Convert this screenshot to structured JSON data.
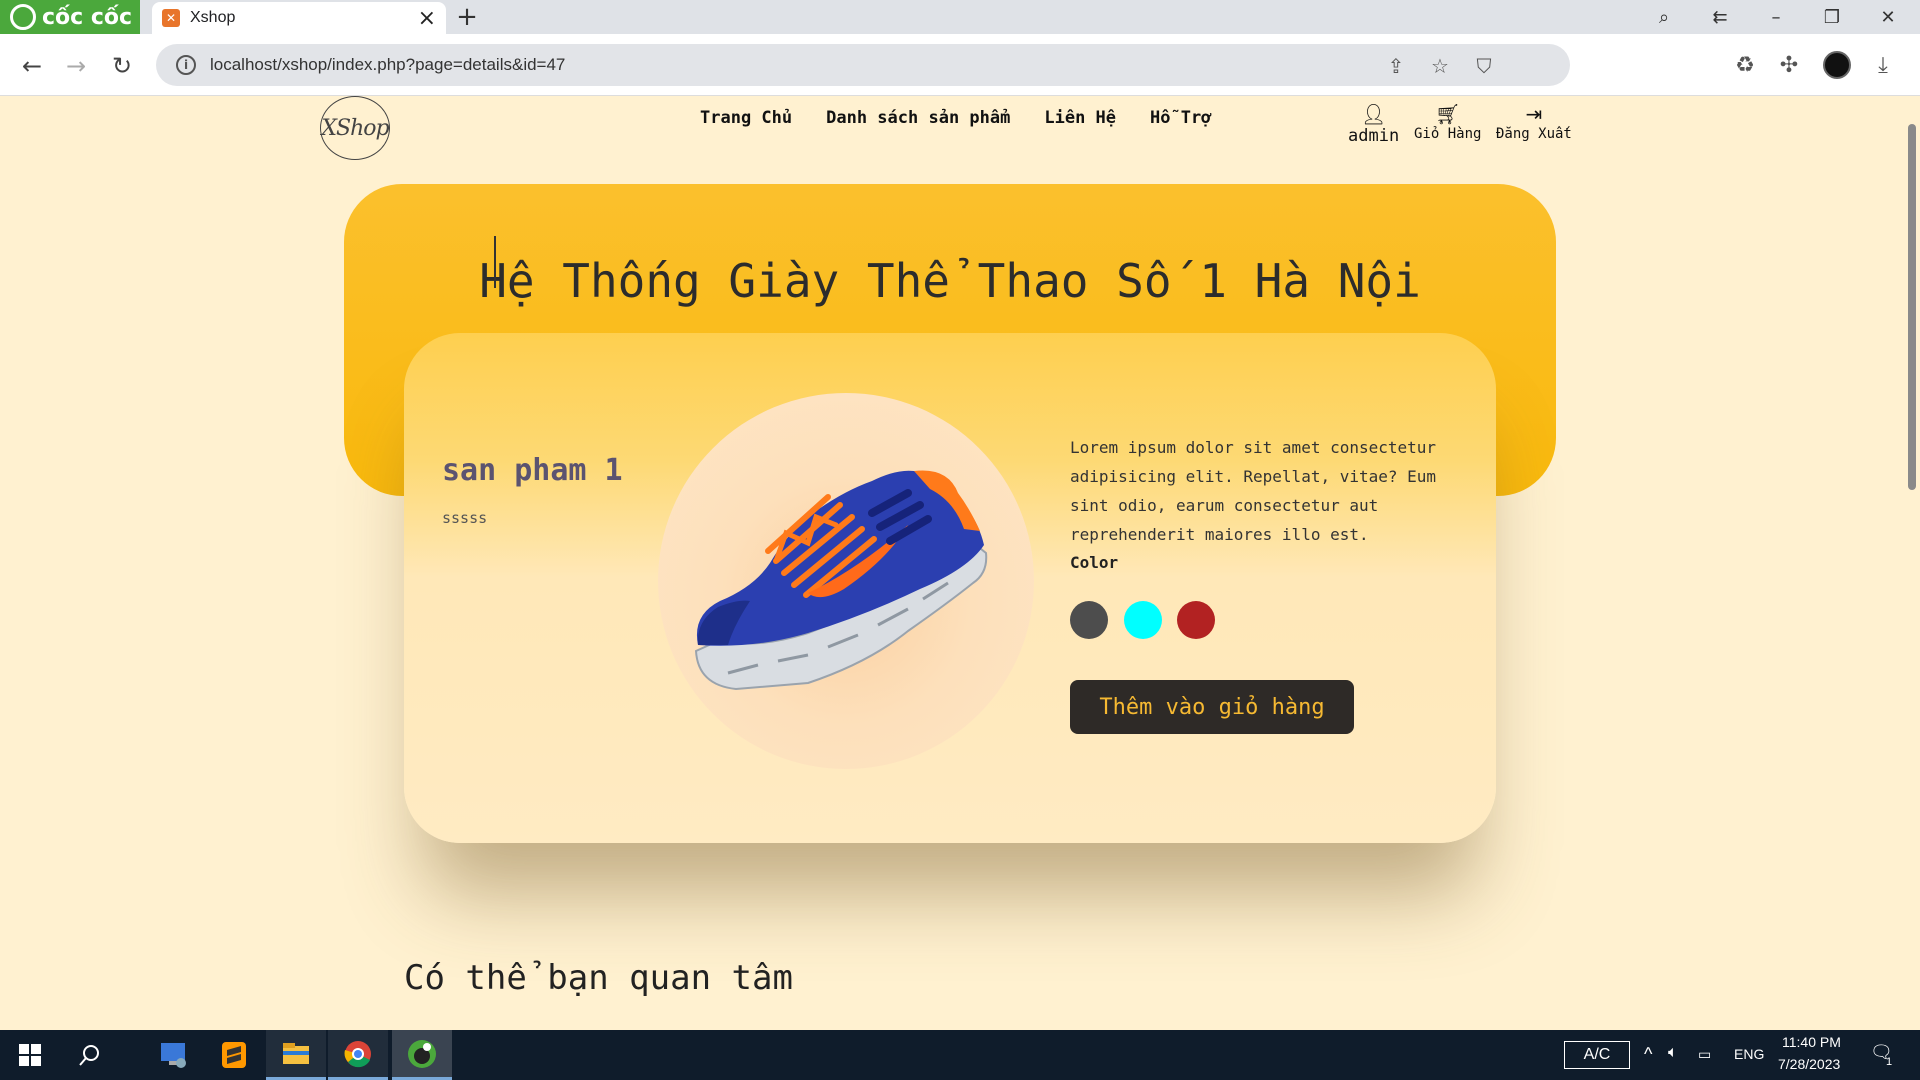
{
  "browser": {
    "brand": "cốc cốc",
    "tab_title": "Xshop",
    "url": "localhost/xshop/index.php?page=details&id=47",
    "icons": [
      "back-icon",
      "forward-icon",
      "reload-icon",
      "info-icon",
      "share-icon",
      "star-icon",
      "shield-icon",
      "recycle-icon",
      "puzzle-icon",
      "profile-icon",
      "download-icon"
    ]
  },
  "site": {
    "logo_text": "XShop",
    "nav": [
      "Trang Chủ",
      "Danh sách sản phẩm",
      "Liên Hệ",
      "Hỗ Trợ"
    ],
    "user": {
      "name": "admin",
      "cart": "Giỏ Hàng",
      "logout": "Đăng Xuất"
    }
  },
  "hero": {
    "title": "Hệ Thống Giày Thể Thao Số 1 Hà Nội"
  },
  "product": {
    "name": "san pham 1",
    "subtitle": "sssss",
    "description": "Lorem ipsum dolor sit amet consectetur adipisicing elit. Repellat, vitae? Eum sint odio, earum consectetur aut reprehenderit maiores illo est.",
    "color_label": "Color",
    "colors": [
      "#4d4d4d",
      "#00ffff",
      "#b22222"
    ],
    "add_to_cart": "Thêm vào giỏ hàng"
  },
  "related": {
    "title": "Có thể bạn quan tâm"
  },
  "taskbar": {
    "ac_label": "A/C",
    "language": "ENG",
    "time": "11:40 PM",
    "date": "7/28/2023",
    "notification_count": "1"
  }
}
